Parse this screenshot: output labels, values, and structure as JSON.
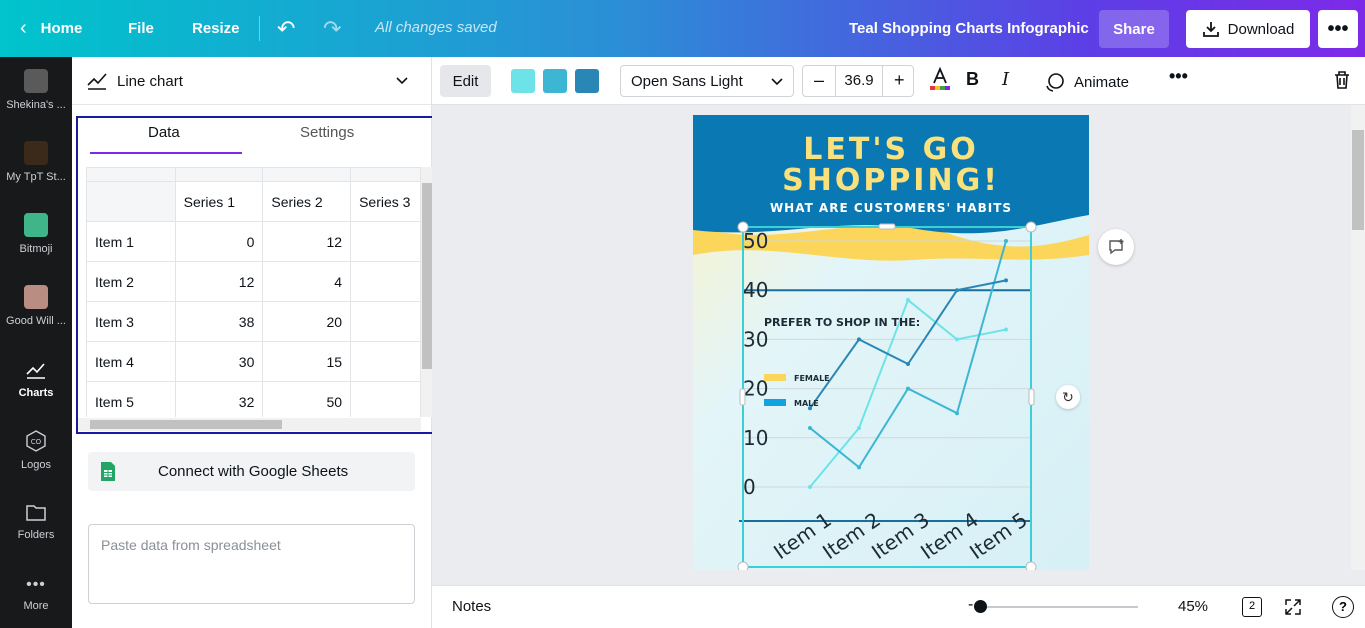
{
  "topbar": {
    "home": "Home",
    "file": "File",
    "resize": "Resize",
    "saved_status": "All changes saved",
    "doc_title": "Teal Shopping Charts Infographic",
    "share": "Share",
    "download": "Download"
  },
  "rail": {
    "items": [
      {
        "label": "Shekina's ..."
      },
      {
        "label": "My TpT St..."
      },
      {
        "label": "Bitmoji"
      },
      {
        "label": "Good Will ..."
      },
      {
        "label": "Charts"
      },
      {
        "label": "Logos"
      },
      {
        "label": "Folders"
      },
      {
        "label": "More"
      }
    ]
  },
  "panel": {
    "chart_type": "Line chart",
    "tabs": {
      "data": "Data",
      "settings": "Settings"
    },
    "table": {
      "headers": [
        "",
        "Series 1",
        "Series 2",
        "Series 3"
      ],
      "rows": [
        {
          "label": "Item 1",
          "s1": "0",
          "s2": "12"
        },
        {
          "label": "Item 2",
          "s1": "12",
          "s2": "4"
        },
        {
          "label": "Item 3",
          "s1": "38",
          "s2": "20"
        },
        {
          "label": "Item 4",
          "s1": "30",
          "s2": "15"
        },
        {
          "label": "Item 5",
          "s1": "32",
          "s2": "50"
        }
      ]
    },
    "sheets_button": "Connect with Google Sheets",
    "paste_placeholder": "Paste data from spreadsheet"
  },
  "toolbar": {
    "edit": "Edit",
    "swatches": [
      "#6ee3e7",
      "#3cb6d3",
      "#2a87b5"
    ],
    "font": "Open Sans Light",
    "font_size": "36.9",
    "animate": "Animate"
  },
  "design": {
    "headline1": "LET'S GO",
    "headline2": "SHOPPING!",
    "subhead": "WHAT ARE CUSTOMERS' HABITS",
    "chart_caption": "PREFER TO SHOP IN THE:",
    "legend_female": "FEMALE",
    "legend_male": "MALE",
    "colors": {
      "header_bg": "#0a79b3",
      "headline": "#fbe17c",
      "yellow": "#fbd65a",
      "line_dark": "#2a87b5",
      "line_light": "#6ee3e7"
    }
  },
  "chart_data": {
    "type": "line",
    "categories": [
      "Item 1",
      "Item 2",
      "Item 3",
      "Item 4",
      "Item 5"
    ],
    "series": [
      {
        "name": "Series 1",
        "values": [
          0,
          12,
          38,
          30,
          32
        ]
      },
      {
        "name": "Series 2",
        "values": [
          12,
          4,
          20,
          15,
          50
        ]
      },
      {
        "name": "Series 3",
        "values": [
          16,
          30,
          25,
          40,
          42
        ]
      }
    ],
    "yticks": [
      "0",
      "10",
      "20",
      "30",
      "40",
      "50"
    ],
    "ylim": [
      0,
      50
    ]
  },
  "bottom": {
    "notes": "Notes",
    "zoom": "45%",
    "page_count": "2"
  }
}
